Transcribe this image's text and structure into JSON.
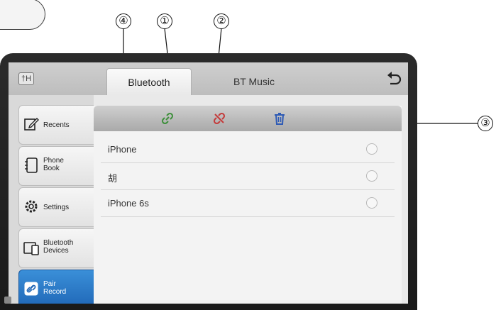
{
  "callouts": [
    "④",
    "①",
    "②",
    "③"
  ],
  "header": {
    "eq_icon_text": "†H",
    "tabs": [
      {
        "label": "Bluetooth",
        "active": true
      },
      {
        "label": "BT Music",
        "active": false
      }
    ],
    "back_icon": "back-arrow-icon"
  },
  "sidebar": {
    "items": [
      {
        "label": "Recents",
        "icon": "recents-icon",
        "active": false
      },
      {
        "label": "Phone Book",
        "icon": "phone-book-icon",
        "active": false
      },
      {
        "label": "Settings",
        "icon": "settings-gear-icon",
        "active": false
      },
      {
        "label": "Bluetooth Devices",
        "icon": "bluetooth-devices-icon",
        "active": false
      },
      {
        "label": "Pair Record",
        "icon": "pair-record-icon",
        "active": true
      }
    ]
  },
  "toolbar": {
    "connect_icon": "link-icon",
    "disconnect_icon": "unlink-icon",
    "delete_icon": "trash-icon",
    "colors": {
      "connect": "#3d8f3a",
      "disconnect": "#c43a3a",
      "delete": "#2f5bb5"
    }
  },
  "pair_list": [
    {
      "name": "iPhone"
    },
    {
      "name": "胡"
    },
    {
      "name": "iPhone 6s"
    }
  ],
  "colors": {
    "active_blue": "#1f66b6"
  }
}
